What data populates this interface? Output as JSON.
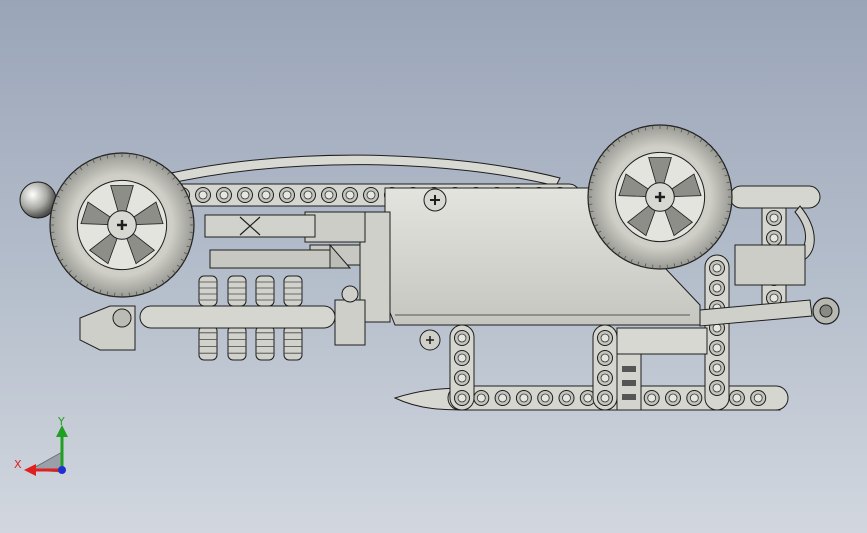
{
  "viewport": {
    "colors": {
      "background_top": "#9aa5b8",
      "background_bottom": "#d2d7df",
      "part_fill": "#d8d8d2",
      "part_stroke": "#1e1e1e",
      "axis_x": "#e02020",
      "axis_y": "#20a020",
      "axis_z": "#2030d0"
    }
  },
  "triad": {
    "x_label": "X",
    "y_label": "Y"
  }
}
